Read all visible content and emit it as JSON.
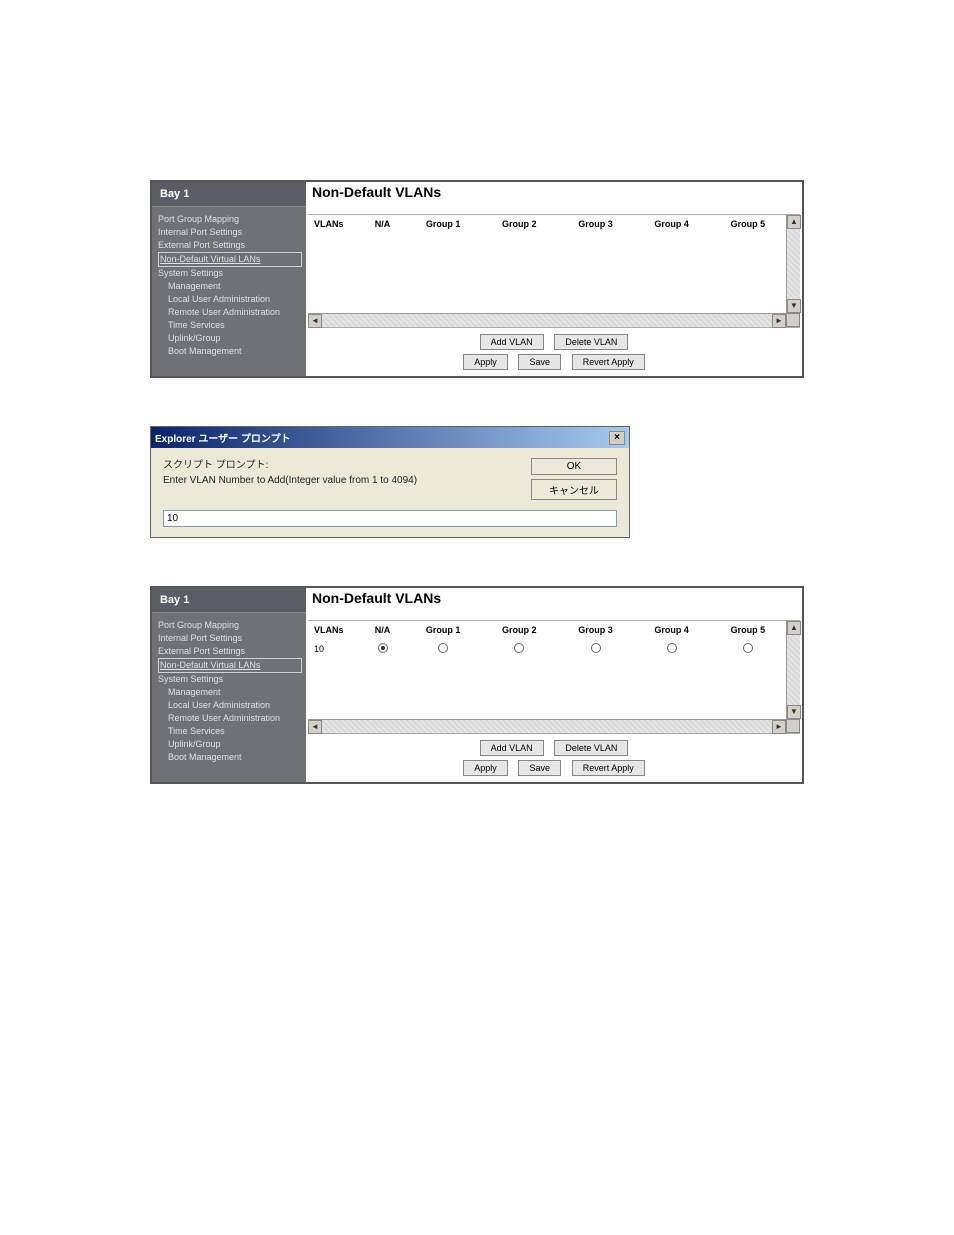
{
  "sidebar": {
    "title": "Bay 1",
    "items": [
      {
        "label": "Port Group Mapping",
        "indent": false,
        "active": false
      },
      {
        "label": "Internal Port Settings",
        "indent": false,
        "active": false
      },
      {
        "label": "External Port Settings",
        "indent": false,
        "active": false
      },
      {
        "label": "Non-Default Virtual LANs",
        "indent": false,
        "active": true
      },
      {
        "label": "System Settings",
        "indent": false,
        "active": false
      },
      {
        "label": "Management",
        "indent": true,
        "active": false
      },
      {
        "label": "Local User Administration",
        "indent": true,
        "active": false
      },
      {
        "label": "Remote User Administration",
        "indent": true,
        "active": false
      },
      {
        "label": "Time Services",
        "indent": true,
        "active": false
      },
      {
        "label": "Uplink/Group",
        "indent": true,
        "active": false
      },
      {
        "label": "Boot Management",
        "indent": true,
        "active": false
      }
    ]
  },
  "page": {
    "title": "Non-Default VLANs",
    "columns": [
      "VLANs",
      "N/A",
      "Group 1",
      "Group 2",
      "Group 3",
      "Group 4",
      "Group 5"
    ]
  },
  "panel2_rows": [
    {
      "vlan": "10",
      "selected_col": 1
    }
  ],
  "buttons": {
    "add_vlan": "Add VLAN",
    "delete_vlan": "Delete VLAN",
    "apply": "Apply",
    "save": "Save",
    "revert_apply": "Revert Apply"
  },
  "dialog": {
    "title": "Explorer ユーザー プロンプト",
    "line1": "スクリプト プロンプト:",
    "line2": "Enter VLAN Number to Add(Integer value from 1 to 4094)",
    "ok": "OK",
    "cancel": "キャンセル",
    "value": "10"
  }
}
